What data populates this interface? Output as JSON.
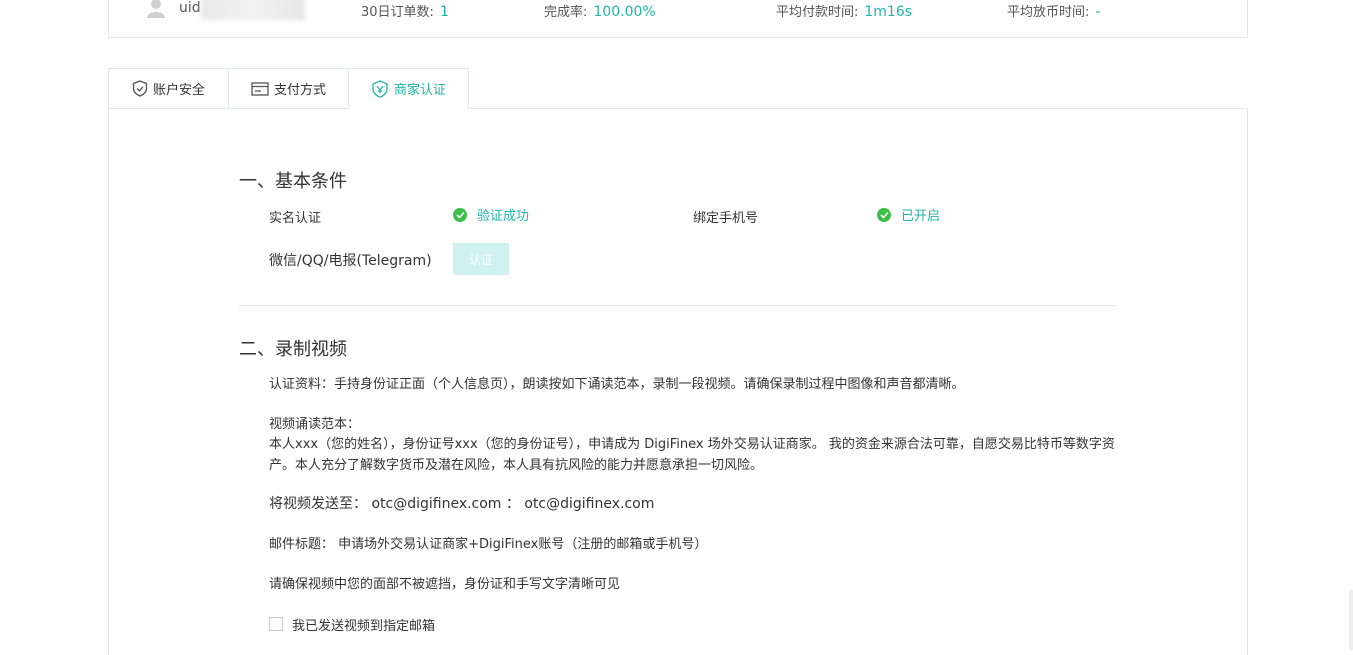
{
  "profile": {
    "uid_label": "uid",
    "stats": [
      {
        "label": "30日订单数:",
        "value": "1"
      },
      {
        "label": "完成率:",
        "value": "100.00%"
      },
      {
        "label": "平均付款时间:",
        "value": "1m16s"
      },
      {
        "label": "平均放币时间:",
        "value": "-"
      }
    ]
  },
  "tabs": [
    {
      "label": "账户安全",
      "icon": "shield-icon"
    },
    {
      "label": "支付方式",
      "icon": "card-icon"
    },
    {
      "label": "商家认证",
      "icon": "merchant-badge-icon",
      "active": true
    }
  ],
  "section1": {
    "title": "一、基本条件",
    "real_name_label": "实名认证",
    "real_name_status": "验证成功",
    "phone_label": "绑定手机号",
    "phone_status": "已开启",
    "social_label": "微信/QQ/电报(Telegram)",
    "verify_button": "认证"
  },
  "section2": {
    "title": "二、录制视频",
    "materials": "认证资料：手持身份证正面（个人信息页），朗读按如下诵读范本，录制一段视频。请确保录制过程中图像和声音都清晰。",
    "template_heading": "视频诵读范本：",
    "template_text": "本人xxx（您的姓名），身份证号xxx（您的身份证号），申请成为 DigiFinex 场外交易认证商家。 我的资金来源合法可靠，自愿交易比特币等数字资产。本人充分了解数字货币及潜在风险，本人具有抗风险的能力并愿意承担一切风险。",
    "send_to": "将视频发送至： otc@digifinex.com ： otc@digifinex.com",
    "email_subject": "邮件标题： 申请场外交易认证商家+DigiFinex账号（注册的邮箱或手机号）",
    "notice": "请确保视频中您的面部不被遮挡，身份证和手写文字清晰可见",
    "checkbox_label": "我已发送视频到指定邮箱"
  },
  "colors": {
    "accent": "#1fb6a6",
    "success": "#3bbf46",
    "border": "#dfe7ef"
  }
}
